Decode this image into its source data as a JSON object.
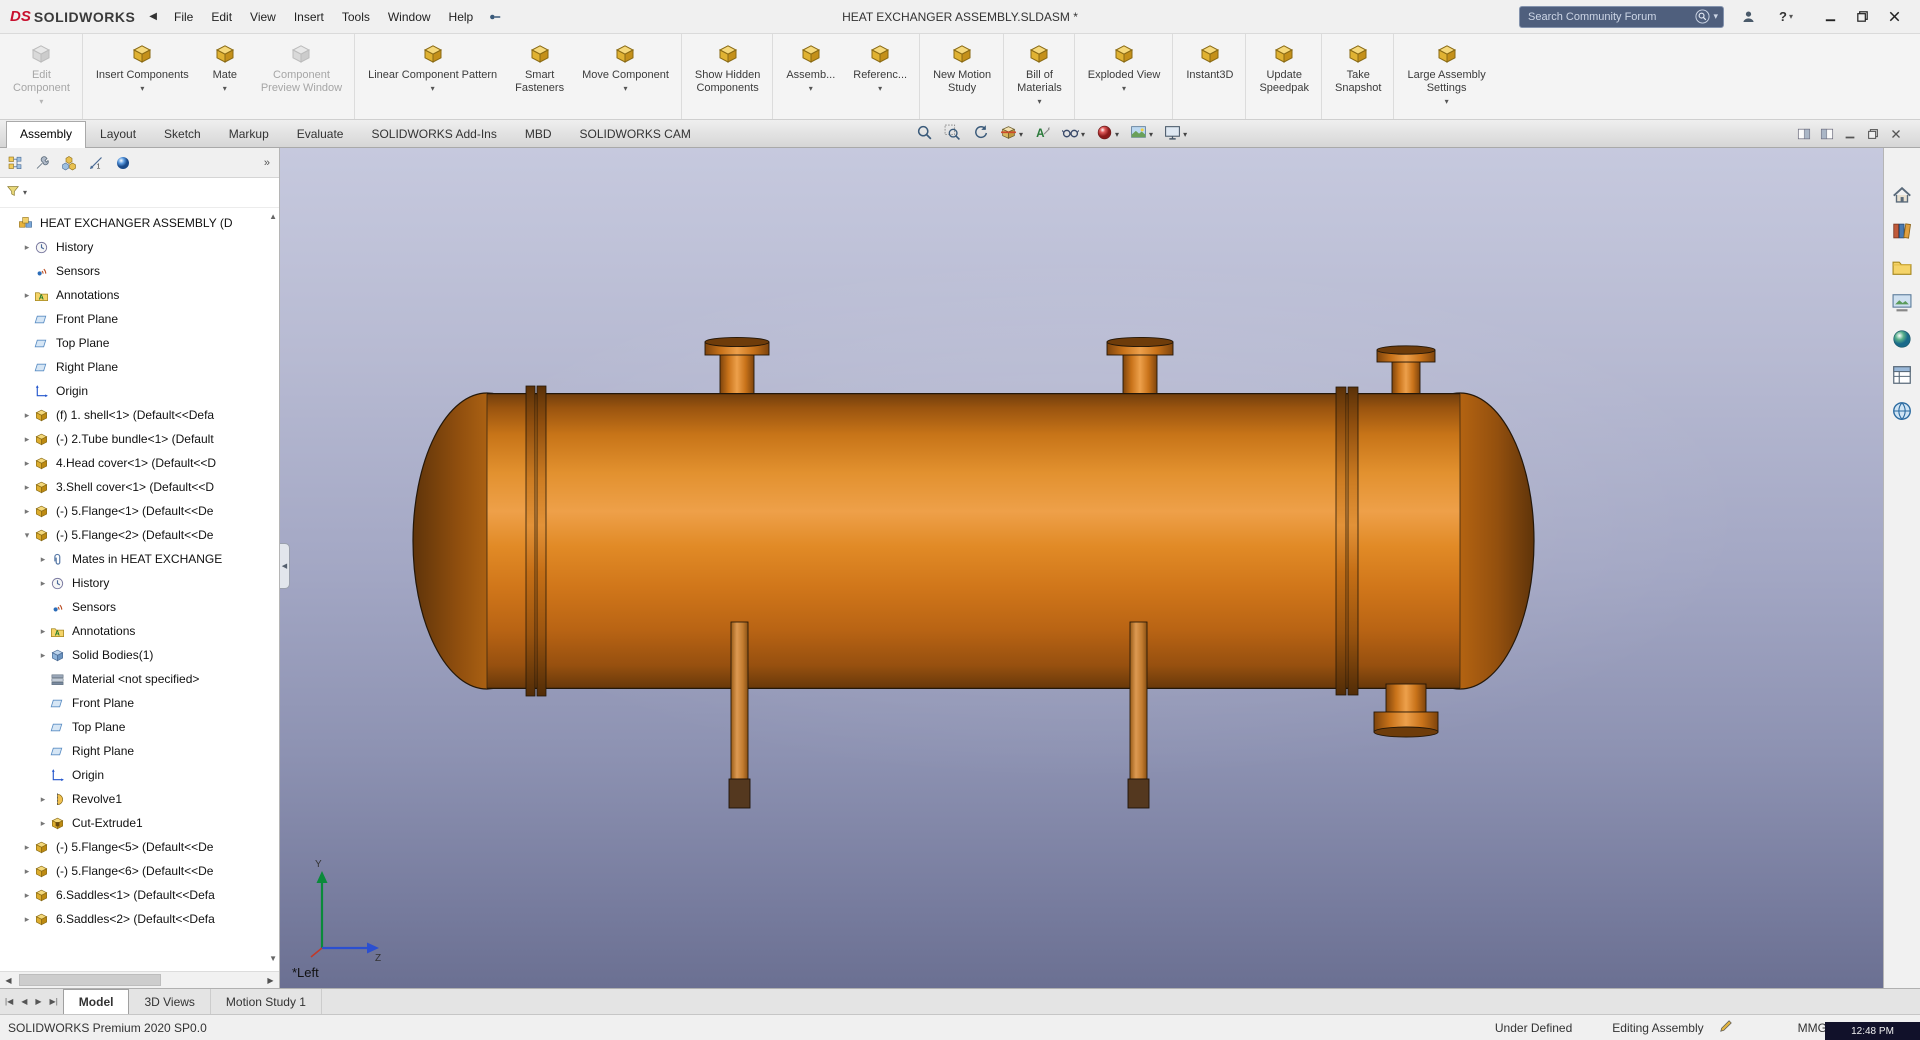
{
  "titlebar": {
    "logo_text": "SOLIDWORKS",
    "document_title": "HEAT EXCHANGER ASSEMBLY.SLDASM *",
    "menus": [
      "File",
      "Edit",
      "View",
      "Insert",
      "Tools",
      "Window",
      "Help"
    ],
    "search_placeholder": "Search Community Forum",
    "help_label": "?"
  },
  "glyphs": {
    "back": "◀",
    "dropdown": "▾",
    "tree_collapsed": "▸",
    "tree_expanded": "▾",
    "overflow": "»",
    "scroll_up": "▲",
    "scroll_down": "▼",
    "scroll_left": "◀",
    "scroll_right": "▶"
  },
  "ribbon": [
    {
      "name": "edit-component",
      "lines": [
        "Edit",
        "Component"
      ],
      "disabled": true,
      "dropdown": true,
      "sep": true
    },
    {
      "name": "insert-components",
      "lines": [
        "Insert Components"
      ],
      "dropdown": true
    },
    {
      "name": "mate",
      "lines": [
        "Mate"
      ],
      "dropdown": true
    },
    {
      "name": "component-preview-window",
      "lines": [
        "Component",
        "Preview Window"
      ],
      "disabled": true,
      "sep": true
    },
    {
      "name": "linear-component-pattern",
      "lines": [
        "Linear Component Pattern"
      ],
      "dropdown": true
    },
    {
      "name": "smart-fasteners",
      "lines": [
        "Smart",
        "Fasteners"
      ]
    },
    {
      "name": "move-component",
      "lines": [
        "Move Component"
      ],
      "dropdown": true,
      "sep": true
    },
    {
      "name": "show-hidden-components",
      "lines": [
        "Show Hidden",
        "Components"
      ],
      "sep": true
    },
    {
      "name": "assembly-features",
      "lines": [
        "Assemb..."
      ],
      "dropdown": true
    },
    {
      "name": "reference-geometry",
      "lines": [
        "Referenc..."
      ],
      "dropdown": true,
      "sep": true
    },
    {
      "name": "new-motion-study",
      "lines": [
        "New Motion",
        "Study"
      ],
      "sep": true
    },
    {
      "name": "bill-of-materials",
      "lines": [
        "Bill of",
        "Materials"
      ],
      "dropdown": true,
      "sep": true
    },
    {
      "name": "exploded-view",
      "lines": [
        "Exploded View"
      ],
      "dropdown": true,
      "sep": true
    },
    {
      "name": "instant3d",
      "lines": [
        "Instant3D"
      ],
      "sep": true
    },
    {
      "name": "update-speedpak",
      "lines": [
        "Update",
        "Speedpak"
      ],
      "sep": true
    },
    {
      "name": "take-snapshot",
      "lines": [
        "Take",
        "Snapshot"
      ],
      "sep": true
    },
    {
      "name": "large-assembly-settings",
      "lines": [
        "Large Assembly",
        "Settings"
      ],
      "dropdown": true
    }
  ],
  "tabs": {
    "active": "Assembly",
    "items": [
      "Assembly",
      "Layout",
      "Sketch",
      "Markup",
      "Evaluate",
      "SOLIDWORKS Add-Ins",
      "MBD",
      "SOLIDWORKS CAM"
    ]
  },
  "headsup": [
    {
      "name": "zoom-to-fit"
    },
    {
      "name": "zoom-to-area"
    },
    {
      "name": "previous-view"
    },
    {
      "name": "section-view",
      "dropdown": true
    },
    {
      "name": "dynamic-annotation-views"
    },
    {
      "name": "hide-show-items",
      "dropdown": true
    },
    {
      "name": "edit-appearance",
      "dropdown": true
    },
    {
      "name": "apply-scene",
      "dropdown": true
    },
    {
      "name": "view-settings",
      "dropdown": true
    }
  ],
  "tabrow_corner": [
    "float-pane",
    "dock-pane",
    "minimize-doc",
    "restore-doc",
    "close-doc"
  ],
  "tree_panel": {
    "tabs": [
      "featuremanager",
      "propertymanager",
      "configurationmanager",
      "dimxpertmanager",
      "displaymanager"
    ]
  },
  "tree": {
    "items": [
      {
        "label": "HEAT EXCHANGER ASSEMBLY  (D",
        "icon": "assembly",
        "level": 0,
        "arrow": "none"
      },
      {
        "label": "History",
        "icon": "history",
        "level": 1,
        "arrow": "collapsed"
      },
      {
        "label": "Sensors",
        "icon": "sensors",
        "level": 1,
        "arrow": "none"
      },
      {
        "label": "Annotations",
        "icon": "annotations",
        "level": 1,
        "arrow": "collapsed"
      },
      {
        "label": "Front Plane",
        "icon": "plane",
        "level": 1,
        "arrow": "none"
      },
      {
        "label": "Top Plane",
        "icon": "plane",
        "level": 1,
        "arrow": "none"
      },
      {
        "label": "Right Plane",
        "icon": "plane",
        "level": 1,
        "arrow": "none"
      },
      {
        "label": "Origin",
        "icon": "origin",
        "level": 1,
        "arrow": "none"
      },
      {
        "label": "(f) 1. shell<1> (Default<<Defa",
        "icon": "part",
        "level": 1,
        "arrow": "collapsed"
      },
      {
        "label": "(-) 2.Tube bundle<1> (Default",
        "icon": "part",
        "level": 1,
        "arrow": "collapsed"
      },
      {
        "label": "4.Head cover<1> (Default<<D",
        "icon": "part",
        "level": 1,
        "arrow": "collapsed"
      },
      {
        "label": "3.Shell cover<1> (Default<<D",
        "icon": "part",
        "level": 1,
        "arrow": "collapsed"
      },
      {
        "label": "(-) 5.Flange<1> (Default<<De",
        "icon": "part",
        "level": 1,
        "arrow": "collapsed"
      },
      {
        "label": "(-) 5.Flange<2> (Default<<De",
        "icon": "part",
        "level": 1,
        "arrow": "expanded"
      },
      {
        "label": "Mates in HEAT EXCHANGE",
        "icon": "mates",
        "level": 2,
        "arrow": "collapsed"
      },
      {
        "label": "History",
        "icon": "history",
        "level": 2,
        "arrow": "collapsed"
      },
      {
        "label": "Sensors",
        "icon": "sensors",
        "level": 2,
        "arrow": "none"
      },
      {
        "label": "Annotations",
        "icon": "annotations",
        "level": 2,
        "arrow": "collapsed"
      },
      {
        "label": "Solid Bodies(1)",
        "icon": "solidbodies",
        "level": 2,
        "arrow": "collapsed"
      },
      {
        "label": "Material <not specified>",
        "icon": "material",
        "level": 2,
        "arrow": "none"
      },
      {
        "label": "Front Plane",
        "icon": "plane",
        "level": 2,
        "arrow": "none"
      },
      {
        "label": "Top Plane",
        "icon": "plane",
        "level": 2,
        "arrow": "none"
      },
      {
        "label": "Right Plane",
        "icon": "plane",
        "level": 2,
        "arrow": "none"
      },
      {
        "label": "Origin",
        "icon": "origin",
        "level": 2,
        "arrow": "none"
      },
      {
        "label": "Revolve1",
        "icon": "revolve",
        "level": 2,
        "arrow": "collapsed"
      },
      {
        "label": "Cut-Extrude1",
        "icon": "cutextrude",
        "level": 2,
        "arrow": "collapsed"
      },
      {
        "label": "(-) 5.Flange<5> (Default<<De",
        "icon": "part",
        "level": 1,
        "arrow": "collapsed"
      },
      {
        "label": "(-) 5.Flange<6> (Default<<De",
        "icon": "part",
        "level": 1,
        "arrow": "collapsed"
      },
      {
        "label": "6.Saddles<1> (Default<<Defa",
        "icon": "part",
        "level": 1,
        "arrow": "collapsed"
      },
      {
        "label": "6.Saddles<2> (Default<<Defa",
        "icon": "part",
        "level": 1,
        "arrow": "collapsed"
      }
    ]
  },
  "viewport": {
    "orientation": "*Left",
    "triad": {
      "up": "Y",
      "right": "Z"
    }
  },
  "taskpane": [
    "home",
    "design-library",
    "file-explorer",
    "view-palette",
    "appearances-scenes",
    "custom-properties",
    "solidworks-forum"
  ],
  "bottom_tabs": {
    "active": "Model",
    "nav": [
      "|◀",
      "◀",
      "▶",
      "▶|"
    ],
    "items": [
      "Model",
      "3D Views",
      "Motion Study 1"
    ]
  },
  "statusbar": {
    "product": "SOLIDWORKS Premium 2020 SP0.0",
    "constraint_status": "Under Defined",
    "mode": "Editing Assembly",
    "units": "MMGS",
    "clock": "12:48 PM"
  },
  "colors": {
    "vessel_orange": "#d9761c",
    "viewport_top": "#c6c9de",
    "viewport_bottom": "#6b7092",
    "accent_red": "#c8102e"
  }
}
